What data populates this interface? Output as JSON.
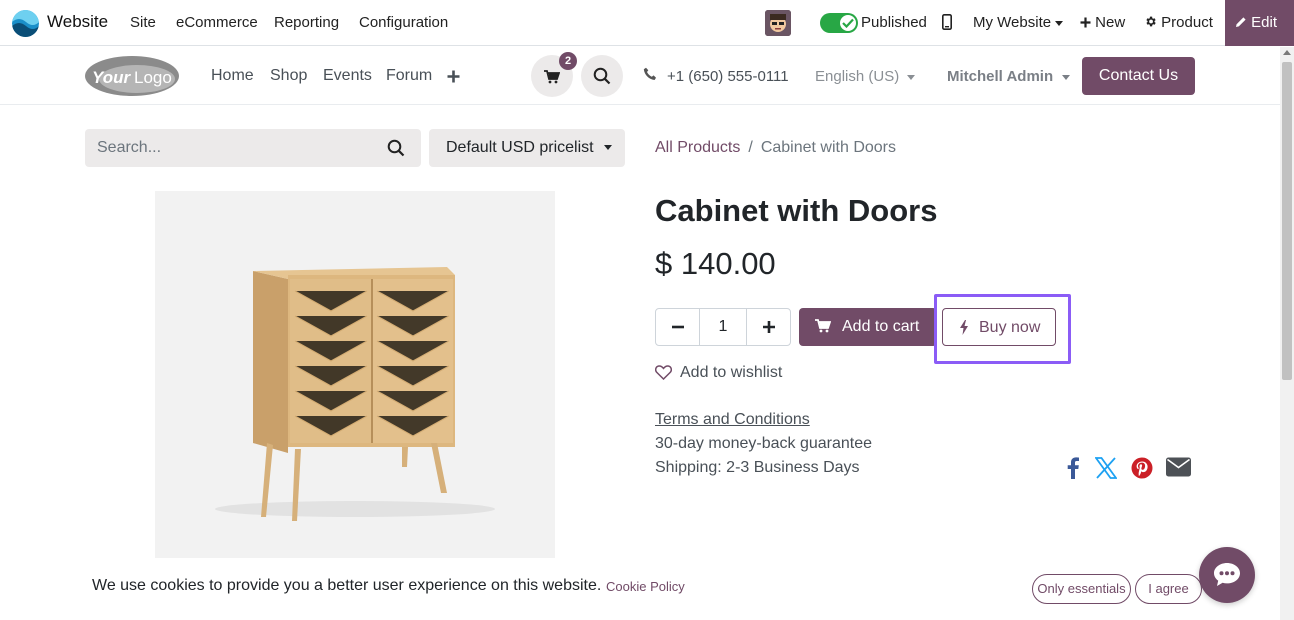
{
  "admin_bar": {
    "app_name": "Website",
    "menus": [
      "Site",
      "eCommerce",
      "Reporting",
      "Configuration"
    ],
    "published_label": "Published",
    "my_website_label": "My Website",
    "new_label": "New",
    "product_label": "Product",
    "edit_label": "Edit"
  },
  "site_header": {
    "logo_text": "YourLogo",
    "nav": [
      "Home",
      "Shop",
      "Events",
      "Forum"
    ],
    "cart_count": "2",
    "phone": "+1 (650) 555-0111",
    "language": "English (US)",
    "user": "Mitchell Admin",
    "contact_label": "Contact Us"
  },
  "product_page": {
    "search_placeholder": "Search...",
    "pricelist": "Default USD pricelist",
    "breadcrumb": {
      "parent": "All Products",
      "separator": "/",
      "current": "Cabinet with Doors"
    },
    "title": "Cabinet with Doors",
    "price": "$ 140.00",
    "quantity": "1",
    "add_to_cart_label": "Add to cart",
    "buy_now_label": "Buy now",
    "wishlist_label": "Add to wishlist",
    "terms_label": "Terms and Conditions",
    "guarantee": "30-day money-back guarantee",
    "shipping": "Shipping: 2-3 Business Days"
  },
  "cookie_bar": {
    "message": "We use cookies to provide you a better user experience on this website.",
    "policy_label": "Cookie Policy",
    "only_essentials_label": "Only essentials",
    "agree_label": "I agree"
  },
  "colors": {
    "brand": "#714b67",
    "highlight": "#8b5cf6",
    "published_toggle": "#28a745",
    "facebook": "#3b5998",
    "x": "#1da1f2",
    "pinterest": "#cb2027",
    "email": "#4d5156"
  }
}
